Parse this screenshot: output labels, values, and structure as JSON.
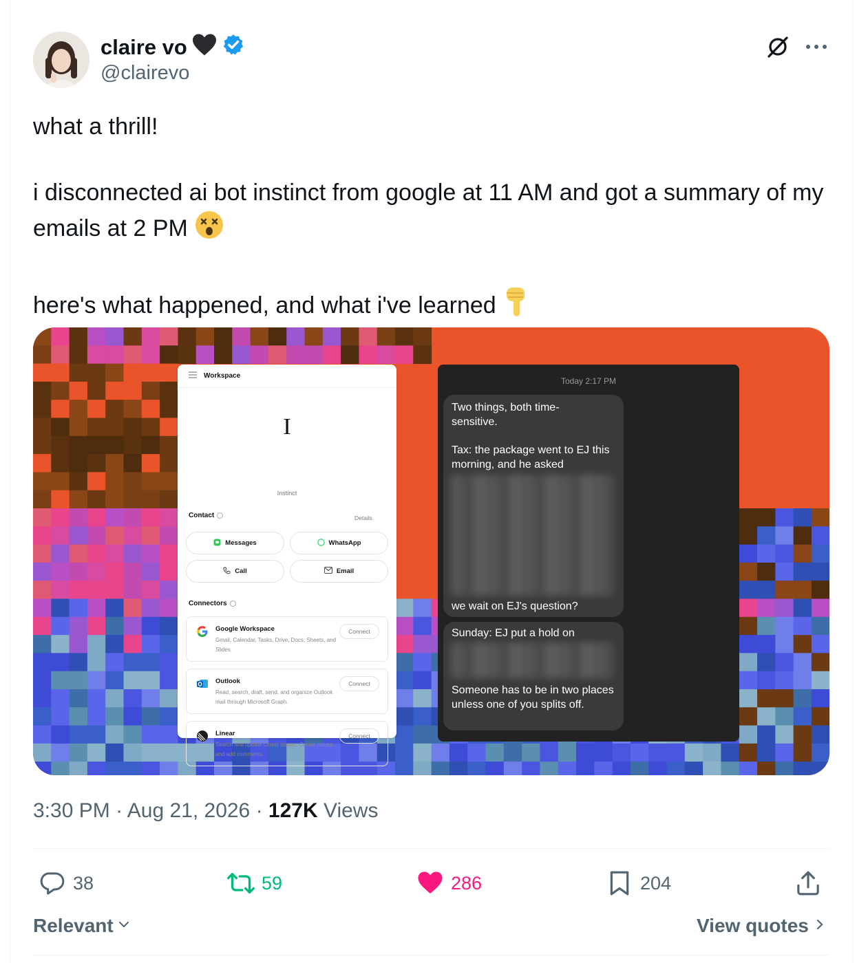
{
  "author": {
    "display_name": "claire vo",
    "handle": "@clairevo",
    "icons": [
      "black-heart-icon",
      "verified-badge-icon"
    ]
  },
  "tweet": {
    "line1": "what a thrill!",
    "line2": "i disconnected ai bot instinct from google at 11 AM and got a summary of my emails at 2 PM",
    "line3": "here's what happened, and what i've learned",
    "emojis": [
      "astonished-face-emoji",
      "backhand-index-pointing-down-emoji"
    ]
  },
  "media": {
    "workspace_card": {
      "header": "Workspace",
      "logo_letter": "I",
      "logo_name": "Instinct",
      "contact_label": "Contact",
      "details_label": "Details",
      "contact_buttons": [
        "Messages",
        "WhatsApp",
        "Call",
        "Email"
      ],
      "connectors_label": "Connectors",
      "connectors": [
        {
          "name": "Google Workspace",
          "desc": "Gmail, Calendar, Tasks, Drive, Docs, Sheets, and Slides",
          "button": "Connect"
        },
        {
          "name": "Outlook",
          "desc": "Read, search, draft, send, and organize Outlook mail through Microsoft Graph.",
          "button": "Connect"
        },
        {
          "name": "Linear",
          "desc": "Search and update Linear issues. Create issues and add comments.",
          "button": "Connect"
        }
      ]
    },
    "chat": {
      "timestamp": "Today 2:17 PM",
      "bubble1_top": "Two things, both time-sensitive.",
      "bubble1_mid": "Tax: the package went to EJ this morning, and he asked",
      "bubble1_bottom": "we wait on EJ's question?",
      "bubble2_top": "Sunday: EJ put a hold on",
      "bubble2_bottom": "Someone has to be in two places unless one of you splits off."
    }
  },
  "meta": {
    "time": "3:30 PM",
    "date": "Aug 21, 2026",
    "views_count": "127K",
    "views_label": "Views"
  },
  "actions": {
    "replies": "38",
    "reposts": "59",
    "likes": "286",
    "bookmarks": "204",
    "like_color": "#f91880",
    "repost_color": "#00ba7c"
  },
  "footer": {
    "relevant": "Relevant",
    "view_quotes": "View quotes"
  },
  "colors": {
    "verified": "#1d9bf0",
    "secondary_text": "#536471",
    "media_bg": "#e9542a"
  }
}
